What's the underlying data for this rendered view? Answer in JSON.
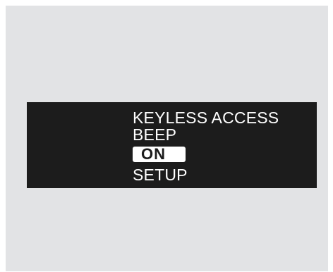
{
  "display": {
    "title_line1": "KEYLESS ACCESS",
    "title_line2": "BEEP",
    "selected_option": "ON",
    "footer_label": "SETUP"
  },
  "colors": {
    "background": "#e2e3e5",
    "screen": "#1c1c1c",
    "text": "#ffffff",
    "highlight": "#ffffff"
  }
}
